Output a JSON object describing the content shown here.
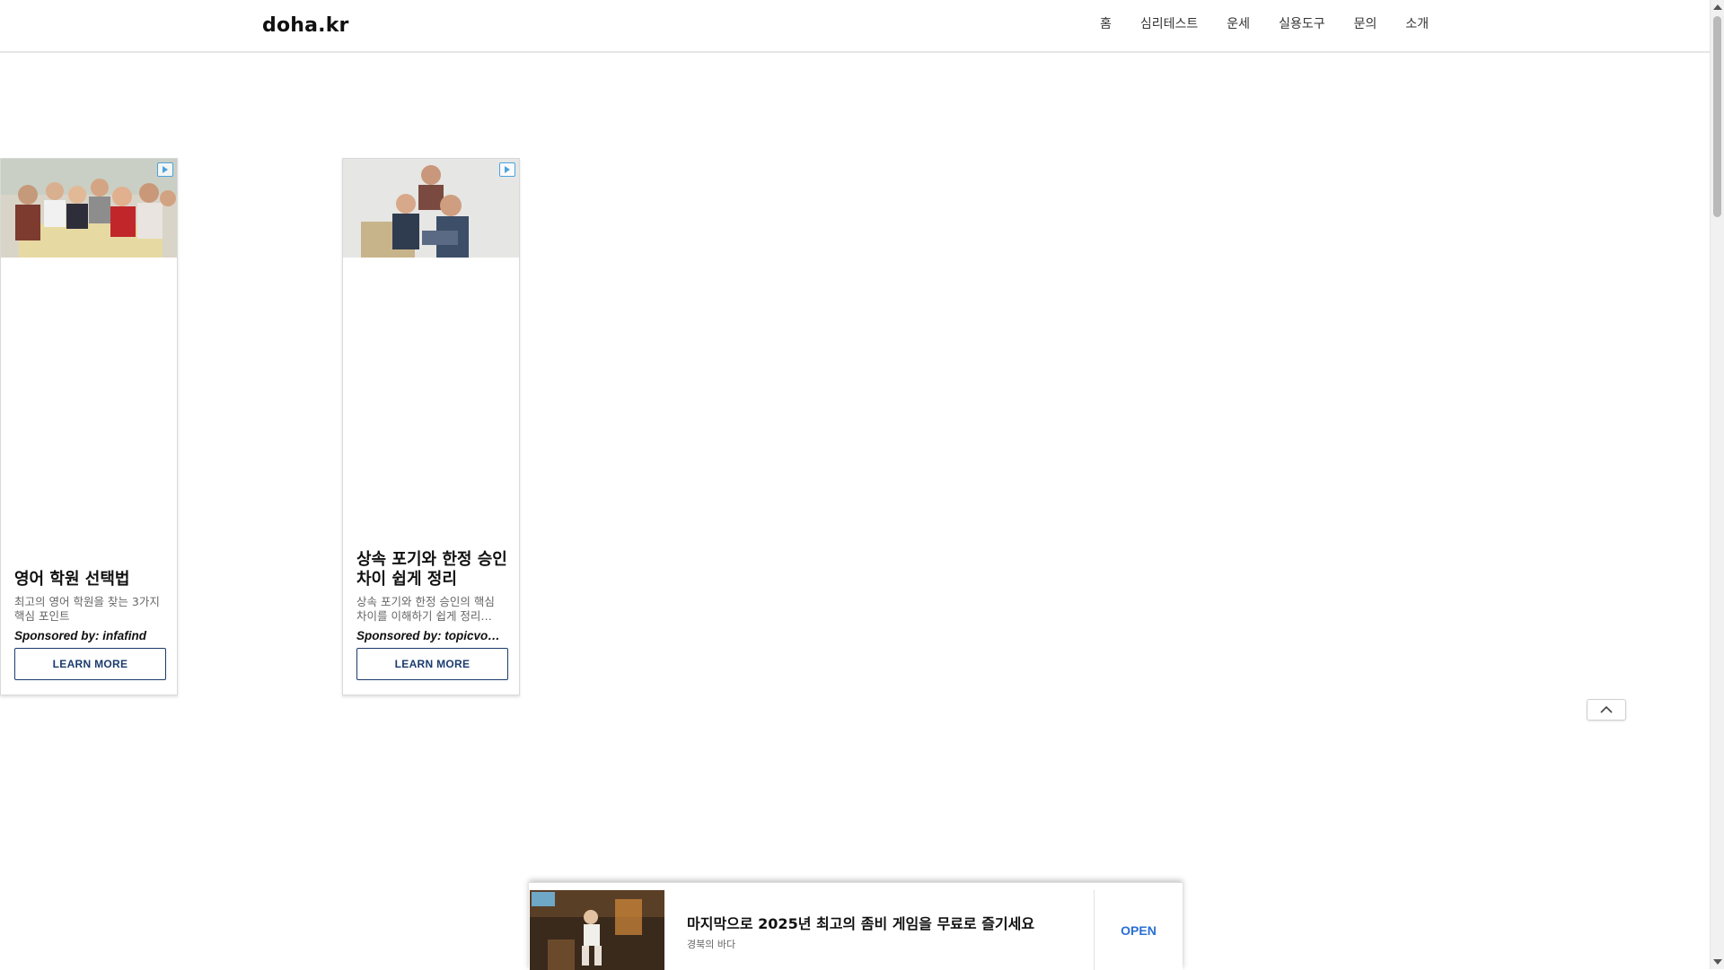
{
  "site": {
    "logo": "doha.kr"
  },
  "nav": {
    "items": [
      {
        "label": "홈"
      },
      {
        "label": "심리테스트"
      },
      {
        "label": "운세"
      },
      {
        "label": "실용도구"
      },
      {
        "label": "문의"
      },
      {
        "label": "소개"
      }
    ]
  },
  "ads": [
    {
      "title": "영어 학원 선택법",
      "description": "최고의 영어 학원을 찾는 3가지 핵심 포인트",
      "sponsor": "Sponsored by: infafind",
      "button": "LEARN MORE",
      "icon": "adchoices-icon"
    },
    {
      "title": "상속 포기와 한정 승인 차이 쉽게 정리",
      "description": "상속 포기와 한정 승인의 핵심 차이를 이해하기 쉽게 정리…",
      "sponsor": "Sponsored by: topicvo…",
      "button": "LEARN MORE",
      "icon": "adchoices-icon"
    }
  ],
  "scroll_top": {
    "icon": "chevron-up-icon"
  },
  "bottom_ad": {
    "headline": "마지막으로 2025년 최고의 좀비 게임을 무료로 즐기세요",
    "source": "경북의 바다",
    "cta": "OPEN"
  },
  "colors": {
    "cta_blue": "#2a6fd4",
    "button_border": "#1a3c6e",
    "header_border": "#e6e6e6"
  }
}
